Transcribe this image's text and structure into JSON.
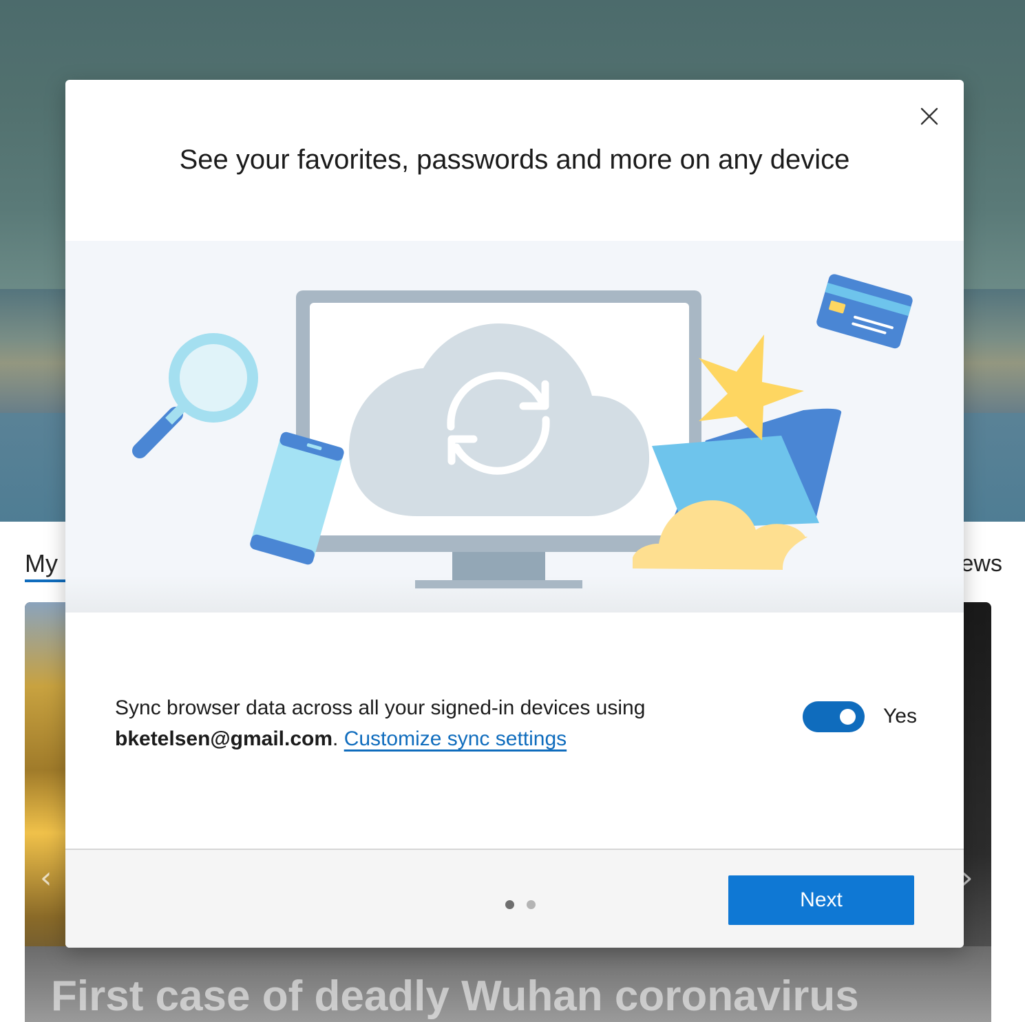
{
  "background": {
    "tab_left": "My",
    "tab_right": "News",
    "headline": "First case of deadly Wuhan coronavirus",
    "prev_arrow": "‹",
    "next_arrow": "›"
  },
  "dialog": {
    "title": "See your favorites, passwords and more on any device",
    "close_icon": "close-icon",
    "illustration_icons": [
      "monitor-icon",
      "cloud-sync-icon",
      "magnifier-icon",
      "phone-icon",
      "star-icon",
      "folder-icon",
      "credit-card-icon",
      "cloud-icon"
    ],
    "sync_text_prefix": "Sync browser data across all your signed-in devices using ",
    "email": "bketelsen@gmail.com",
    "period": ". ",
    "customize_link": "Customize sync settings",
    "toggle_on": true,
    "toggle_label": "Yes",
    "pager_total": 2,
    "pager_current": 1,
    "next_label": "Next"
  },
  "colors": {
    "accent": "#0f6cbd",
    "button": "#0f78d4"
  }
}
